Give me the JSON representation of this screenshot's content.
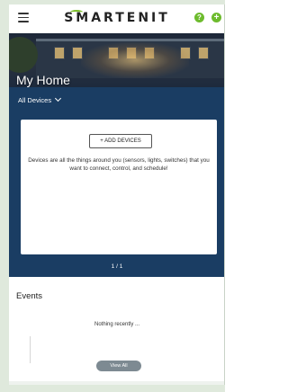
{
  "header": {
    "logo_text": "SMARTENIT",
    "help_icon": "?",
    "add_icon": "+",
    "accent_color": "#6dbb2d",
    "icons": [
      "menu-icon",
      "help-icon",
      "add-icon"
    ]
  },
  "hero": {
    "title": "My Home"
  },
  "devices": {
    "filter_label": "All Devices",
    "add_button_label": "+ ADD DEVICES",
    "description": "Devices are all the things around you (sensors, lights, switches) that you want to connect, control, and schedule!",
    "pager": "1 / 1",
    "panel_color": "#1a3d63"
  },
  "events": {
    "title": "Events",
    "empty_text": "Nothing recently ...",
    "view_all_label": "View All"
  }
}
